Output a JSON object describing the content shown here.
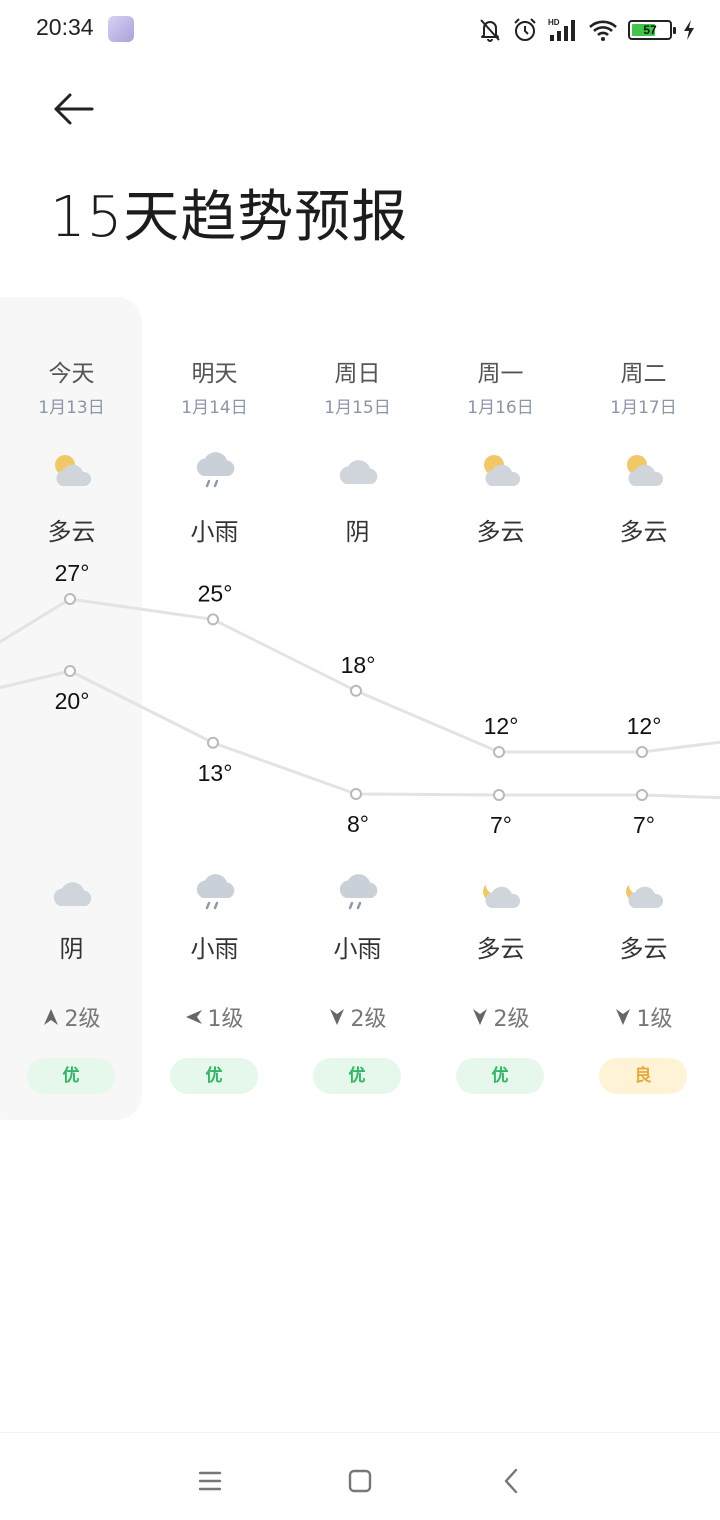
{
  "status_bar": {
    "time": "20:34",
    "battery_level": "57",
    "icons": [
      "app-avatar-icon",
      "bell-off-icon",
      "alarm-icon",
      "hd-signal-icon",
      "wifi-icon",
      "battery-icon",
      "charging-bolt-icon"
    ]
  },
  "header": {
    "back_icon": "arrow-left-icon",
    "title": "15天趋势预报"
  },
  "days": [
    {
      "label": "今天",
      "date": "1月13日",
      "day_icon": "partly-cloudy-day-icon",
      "day_condition": "多云",
      "high": "27°",
      "low": "20°",
      "night_icon": "cloudy-icon",
      "night_condition": "阴",
      "wind_direction": "up",
      "wind_level": "2级",
      "aqi": "优",
      "aqi_level": "good"
    },
    {
      "label": "明天",
      "date": "1月14日",
      "day_icon": "light-rain-icon",
      "day_condition": "小雨",
      "high": "25°",
      "low": "13°",
      "night_icon": "light-rain-icon",
      "night_condition": "小雨",
      "wind_direction": "left",
      "wind_level": "1级",
      "aqi": "优",
      "aqi_level": "good"
    },
    {
      "label": "周日",
      "date": "1月15日",
      "day_icon": "cloudy-icon",
      "day_condition": "阴",
      "high": "18°",
      "low": "8°",
      "night_icon": "light-rain-icon",
      "night_condition": "小雨",
      "wind_direction": "down",
      "wind_level": "2级",
      "aqi": "优",
      "aqi_level": "good"
    },
    {
      "label": "周一",
      "date": "1月16日",
      "day_icon": "partly-cloudy-day-icon",
      "day_condition": "多云",
      "high": "12°",
      "low": "7°",
      "night_icon": "partly-cloudy-night-icon",
      "night_condition": "多云",
      "wind_direction": "down",
      "wind_level": "2级",
      "aqi": "优",
      "aqi_level": "good"
    },
    {
      "label": "周二",
      "date": "1月17日",
      "day_icon": "partly-cloudy-day-icon",
      "day_condition": "多云",
      "high": "12°",
      "low": "7°",
      "night_icon": "partly-cloudy-night-icon",
      "night_condition": "多云",
      "wind_direction": "down",
      "wind_level": "1级",
      "aqi": "良",
      "aqi_level": "moderate"
    }
  ],
  "temperature_trend": {
    "high": [
      27,
      25,
      18,
      12,
      12
    ],
    "low": [
      20,
      13,
      8,
      7,
      7
    ]
  },
  "colors": {
    "aqi_good_bg": "#e6f7ec",
    "aqi_good_text": "#2fb865",
    "aqi_moderate_bg": "#fff3d6",
    "aqi_moderate_text": "#e8a93a",
    "trend_line": "#e3e3e3"
  },
  "nav_bar": {
    "icons": [
      "menu-icon",
      "home-square-icon",
      "back-chevron-icon"
    ]
  }
}
